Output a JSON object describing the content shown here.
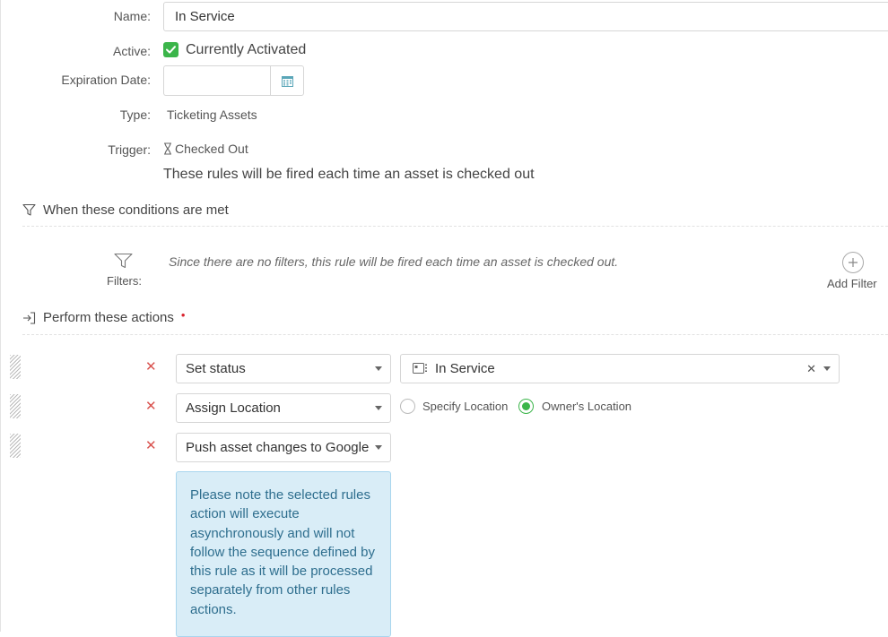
{
  "form": {
    "name_label": "Name:",
    "name_value": "In Service",
    "active_label": "Active:",
    "active_text": "Currently Activated",
    "expiration_label": "Expiration Date:",
    "expiration_value": "",
    "type_label": "Type:",
    "type_value": "Ticketing Assets",
    "trigger_label": "Trigger:",
    "trigger_value": "Checked Out",
    "trigger_description": "These rules will be fired each time an asset is checked out"
  },
  "conditions": {
    "heading": "When these conditions are met",
    "filters_label": "Filters:",
    "empty_note": "Since there are no filters, this rule will be fired each time an asset is checked out.",
    "add_filter_label": "Add Filter"
  },
  "actions": {
    "heading": "Perform these actions",
    "required_marker": "•",
    "rows": [
      {
        "action": "Set status",
        "status_value": "In Service"
      },
      {
        "action": "Assign Location",
        "options": [
          "Specify Location",
          "Owner's Location"
        ],
        "selected": "Owner's Location"
      },
      {
        "action": "Push asset changes to Google"
      }
    ],
    "remove_symbol": "✕",
    "clear_symbol": "✕",
    "note": "Please note the selected rules action will execute asynchronously and will not follow the sequence defined by this rule as it will be processed separately from other rules actions."
  },
  "colors": {
    "accent_green": "#3bb54a",
    "danger_red": "#d9534f",
    "info_bg": "#d9edf7",
    "info_text": "#2e6e8e",
    "calendar_icon": "#5aa6b8"
  },
  "icons": {
    "checkbox": "check-icon",
    "expiration": "calendar-icon",
    "trigger": "hourglass-icon",
    "conditions": "funnel-icon",
    "actions": "sign-in-arrow-icon",
    "add_filter": "plus-circle-icon",
    "status": "status-card-icon"
  }
}
